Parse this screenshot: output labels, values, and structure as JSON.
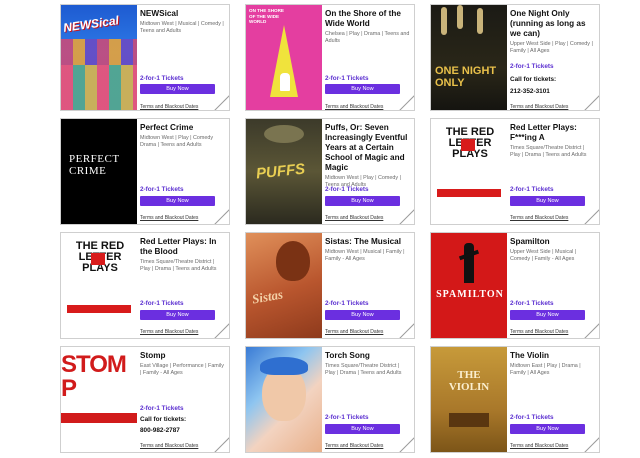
{
  "shows": [
    {
      "title": "NEWSical",
      "meta": "Midtown West | Musical | Comedy | Teens and Adults",
      "deal": "2-for-1 Tickets",
      "buy": "Buy Now",
      "terms": "Terms and Blackout Dates",
      "poster_text": "NEWSical"
    },
    {
      "title": "On the Shore of the Wide World",
      "meta": "Chelsea | Play | Drama | Teens and Adults",
      "deal": "2-for-1 Tickets",
      "buy": "Buy Now",
      "terms": "Terms and Blackout Dates",
      "poster_text": "ON THE SHORE OF THE WIDE WORLD"
    },
    {
      "title": "One Night Only (running as long as we can)",
      "meta": "Upper West Side | Play | Comedy | Family | All Ages",
      "deal": "2-for-1 Tickets",
      "call_label": "Call for tickets:",
      "phone": "212-352-3101",
      "terms": "Terms and Blackout Dates",
      "poster_text": "ONE NIGHT ONLY"
    },
    {
      "title": "Perfect Crime",
      "meta": "Midtown West | Play | Comedy Drama | Teens and Adults",
      "deal": "2-for-1 Tickets",
      "buy": "Buy Now",
      "terms": "Terms and Blackout Dates",
      "poster_text": "PERFECT CRIME"
    },
    {
      "title": "Puffs, Or: Seven Increasingly Eventful Years at a Certain School of Magic and Magic",
      "meta": "Midtown West | Play | Comedy | Teens and Adults",
      "deal": "2-for-1 Tickets",
      "buy": "Buy Now",
      "terms": "Terms and Blackout Dates",
      "poster_text": "PUFFS"
    },
    {
      "title": "Red Letter Plays: F***ing A",
      "meta": "Times Square/Theatre District | Play | Drama | Teens and Adults",
      "deal": "2-for-1 Tickets",
      "buy": "Buy Now",
      "terms": "Terms and Blackout Dates",
      "poster_text": "THE RED LETTER PLAYS"
    },
    {
      "title": "Red Letter Plays: In the Blood",
      "meta": "Times Square/Theatre District | Play | Drama | Teens and Adults",
      "deal": "2-for-1 Tickets",
      "buy": "Buy Now",
      "terms": "Terms and Blackout Dates",
      "poster_text": "THE RED LETTER PLAYS"
    },
    {
      "title": "Sistas: The Musical",
      "meta": "Midtown West | Musical | Family | Family - All Ages",
      "deal": "2-for-1 Tickets",
      "buy": "Buy Now",
      "terms": "Terms and Blackout Dates",
      "poster_text": "Sistas"
    },
    {
      "title": "Spamilton",
      "meta": "Upper West Side | Musical | Comedy | Family - All Ages",
      "deal": "2-for-1 Tickets",
      "buy": "Buy Now",
      "terms": "Terms and Blackout Dates",
      "poster_text": "SPAMILTON"
    },
    {
      "title": "Stomp",
      "meta": "East Village | Performance | Family | Family - All Ages",
      "deal": "2-for-1 Tickets",
      "call_label": "Call for tickets:",
      "phone": "800-982-2787",
      "terms": "Terms and Blackout Dates",
      "poster_text": "STOMP"
    },
    {
      "title": "Torch Song",
      "meta": "Times Square/Theatre District | Play | Drama | Teens and Adults",
      "deal": "2-for-1 Tickets",
      "buy": "Buy Now",
      "terms": "Terms and Blackout Dates",
      "poster_text": ""
    },
    {
      "title": "The Violin",
      "meta": "Midtown East | Play | Drama | Family | All Ages",
      "deal": "2-for-1 Tickets",
      "buy": "Buy Now",
      "terms": "Terms and Blackout Dates",
      "poster_text": "THE VIOLIN"
    }
  ],
  "colors": {
    "accent": "#6b2fe0",
    "deal_text": "#5b2fd0"
  }
}
